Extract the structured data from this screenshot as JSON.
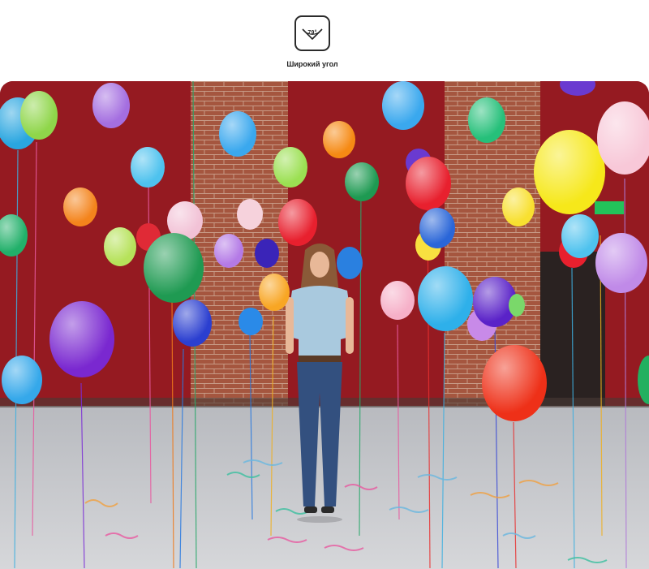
{
  "camera_mode": {
    "icon": "wide-angle-icon",
    "angle_value": "79°",
    "label": "Широкий угол"
  },
  "photo": {
    "description_icon": "photo",
    "colors": {
      "wall_red": "#9b1b22",
      "brick": "#a85a42",
      "floor": "#c9cbd0"
    }
  }
}
